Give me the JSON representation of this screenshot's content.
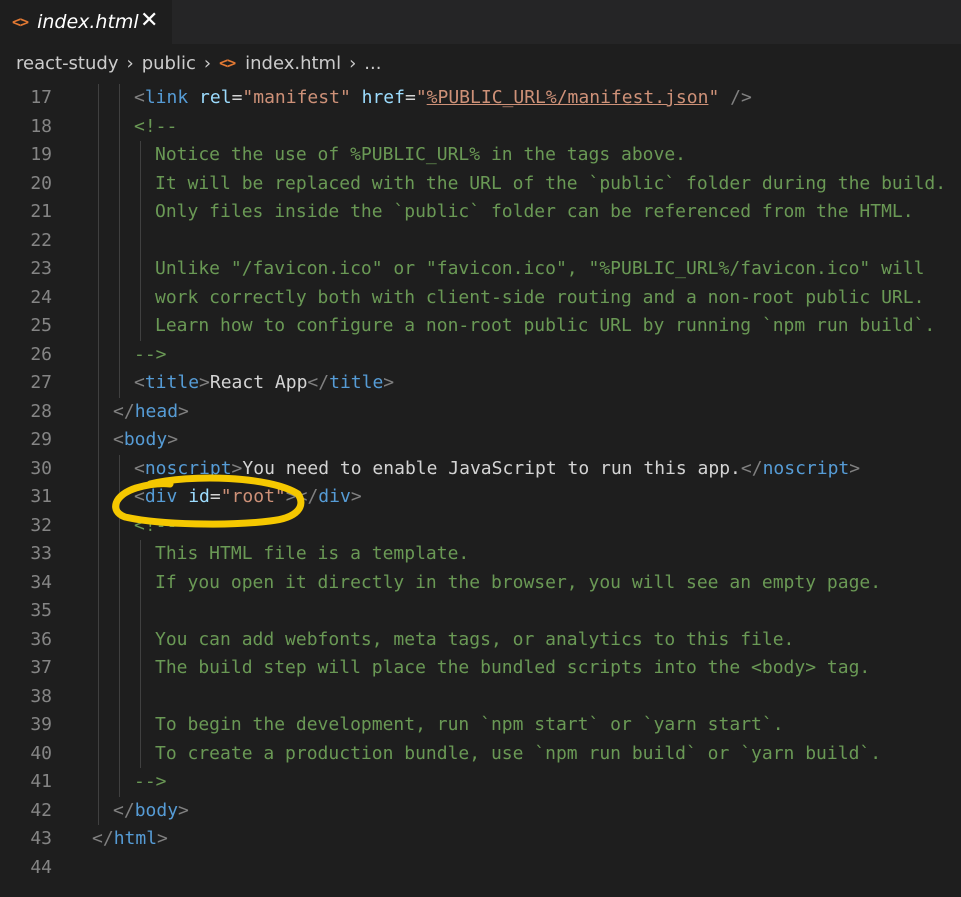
{
  "tab": {
    "icon": "html-file-icon",
    "label": "index.html"
  },
  "breadcrumb": {
    "items": [
      "react-study",
      "public",
      "index.html",
      "..."
    ]
  },
  "colors": {
    "comment": "#6a9955",
    "tag": "#569cd6",
    "attr": "#9cdcfe",
    "string": "#ce9178",
    "annotation": "#f5c800"
  },
  "lines": [
    {
      "num": "17",
      "indent": 2,
      "segs": [
        [
          "t",
          "<"
        ],
        [
          "n",
          "link"
        ],
        [
          "w",
          " "
        ],
        [
          "a",
          "rel"
        ],
        [
          "w",
          "="
        ],
        [
          "s",
          "\"manifest\""
        ],
        [
          "w",
          " "
        ],
        [
          "a",
          "href"
        ],
        [
          "w",
          "="
        ],
        [
          "s",
          "\""
        ],
        [
          "su",
          "%PUBLIC_URL%/manifest.json"
        ],
        [
          "s",
          "\""
        ],
        [
          "w",
          " "
        ],
        [
          "t",
          "/>"
        ]
      ]
    },
    {
      "num": "18",
      "indent": 2,
      "segs": [
        [
          "c",
          "<!--"
        ]
      ]
    },
    {
      "num": "19",
      "indent": 3,
      "segs": [
        [
          "c",
          "Notice the use of %PUBLIC_URL% in the tags above."
        ]
      ]
    },
    {
      "num": "20",
      "indent": 3,
      "segs": [
        [
          "c",
          "It will be replaced with the URL of the `public` folder during the build."
        ]
      ]
    },
    {
      "num": "21",
      "indent": 3,
      "segs": [
        [
          "c",
          "Only files inside the `public` folder can be referenced from the HTML."
        ]
      ]
    },
    {
      "num": "22",
      "indent": 3,
      "segs": []
    },
    {
      "num": "23",
      "indent": 3,
      "segs": [
        [
          "c",
          "Unlike \"/favicon.ico\" or \"favicon.ico\", \"%PUBLIC_URL%/favicon.ico\" will"
        ]
      ]
    },
    {
      "num": "24",
      "indent": 3,
      "segs": [
        [
          "c",
          "work correctly both with client-side routing and a non-root public URL."
        ]
      ]
    },
    {
      "num": "25",
      "indent": 3,
      "segs": [
        [
          "c",
          "Learn how to configure a non-root public URL by running `npm run build`."
        ]
      ]
    },
    {
      "num": "26",
      "indent": 2,
      "segs": [
        [
          "c",
          "-->"
        ]
      ]
    },
    {
      "num": "27",
      "indent": 2,
      "segs": [
        [
          "t",
          "<"
        ],
        [
          "n",
          "title"
        ],
        [
          "t",
          ">"
        ],
        [
          "w",
          "React App"
        ],
        [
          "t",
          "</"
        ],
        [
          "n",
          "title"
        ],
        [
          "t",
          ">"
        ]
      ]
    },
    {
      "num": "28",
      "indent": 1,
      "segs": [
        [
          "t",
          "</"
        ],
        [
          "n",
          "head"
        ],
        [
          "t",
          ">"
        ]
      ]
    },
    {
      "num": "29",
      "indent": 1,
      "segs": [
        [
          "t",
          "<"
        ],
        [
          "n",
          "body"
        ],
        [
          "t",
          ">"
        ]
      ]
    },
    {
      "num": "30",
      "indent": 2,
      "segs": [
        [
          "t",
          "<"
        ],
        [
          "n",
          "noscript"
        ],
        [
          "t",
          ">"
        ],
        [
          "w",
          "You need to enable JavaScript to run this app."
        ],
        [
          "t",
          "</"
        ],
        [
          "n",
          "noscript"
        ],
        [
          "t",
          ">"
        ]
      ]
    },
    {
      "num": "31",
      "indent": 2,
      "segs": [
        [
          "t",
          "<"
        ],
        [
          "n",
          "div"
        ],
        [
          "w",
          " "
        ],
        [
          "a",
          "id"
        ],
        [
          "w",
          "="
        ],
        [
          "s",
          "\"root\""
        ],
        [
          "t",
          ">"
        ],
        [
          "t",
          "</"
        ],
        [
          "n",
          "div"
        ],
        [
          "t",
          ">"
        ]
      ]
    },
    {
      "num": "32",
      "indent": 2,
      "segs": [
        [
          "c",
          "<!--"
        ]
      ]
    },
    {
      "num": "33",
      "indent": 3,
      "segs": [
        [
          "c",
          "This HTML file is a template."
        ]
      ]
    },
    {
      "num": "34",
      "indent": 3,
      "segs": [
        [
          "c",
          "If you open it directly in the browser, you will see an empty page."
        ]
      ]
    },
    {
      "num": "35",
      "indent": 3,
      "segs": []
    },
    {
      "num": "36",
      "indent": 3,
      "segs": [
        [
          "c",
          "You can add webfonts, meta tags, or analytics to this file."
        ]
      ]
    },
    {
      "num": "37",
      "indent": 3,
      "segs": [
        [
          "c",
          "The build step will place the bundled scripts into the <body> tag."
        ]
      ]
    },
    {
      "num": "38",
      "indent": 3,
      "segs": []
    },
    {
      "num": "39",
      "indent": 3,
      "segs": [
        [
          "c",
          "To begin the development, run `npm start` or `yarn start`."
        ]
      ]
    },
    {
      "num": "40",
      "indent": 3,
      "segs": [
        [
          "c",
          "To create a production bundle, use `npm run build` or `yarn build`."
        ]
      ]
    },
    {
      "num": "41",
      "indent": 2,
      "segs": [
        [
          "c",
          "-->"
        ]
      ]
    },
    {
      "num": "42",
      "indent": 1,
      "segs": [
        [
          "t",
          "</"
        ],
        [
          "n",
          "body"
        ],
        [
          "t",
          ">"
        ]
      ]
    },
    {
      "num": "43",
      "indent": 0,
      "segs": [
        [
          "t",
          "</"
        ],
        [
          "n",
          "html"
        ],
        [
          "t",
          ">"
        ]
      ]
    },
    {
      "num": "44",
      "indent": 0,
      "segs": []
    }
  ]
}
